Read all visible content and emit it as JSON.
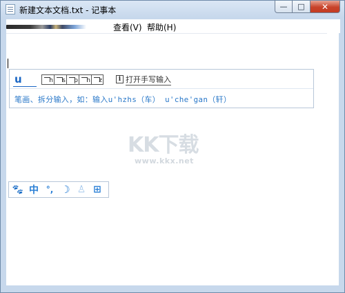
{
  "window": {
    "title": "新建文本文档.txt - 记事本",
    "controls": {
      "minimize": "—",
      "maximize": "□",
      "close": "✕"
    }
  },
  "menubar": {
    "items": [
      {
        "label": "查看(V)"
      },
      {
        "label": "帮助(H)"
      }
    ]
  },
  "ime": {
    "input_text": "u",
    "stroke_keys": [
      "h",
      "s",
      "p",
      "n",
      "z"
    ],
    "handwrite_label": "打开手写输入",
    "hint": "笔画、拆分输入，如：输入u'hzhs（车）  u'che'gan（轩）"
  },
  "watermark": {
    "logo": "KK下载",
    "url": "www.kkx.net"
  },
  "ime_toolbar": {
    "items": [
      {
        "icon": "paw-icon",
        "glyph": "🐾"
      },
      {
        "icon": "chinese-mode-icon",
        "glyph": "中"
      },
      {
        "icon": "punctuation-icon",
        "glyph": "°,"
      },
      {
        "icon": "moon-icon",
        "glyph": "☽"
      },
      {
        "icon": "user-icon",
        "glyph": "♙"
      },
      {
        "icon": "grid-icon",
        "glyph": "⊞"
      }
    ]
  },
  "colors": {
    "accent": "#1a66c4",
    "hint_text": "#2b79c9",
    "chrome": "#c7d8ec",
    "close_button": "#c8432a"
  }
}
